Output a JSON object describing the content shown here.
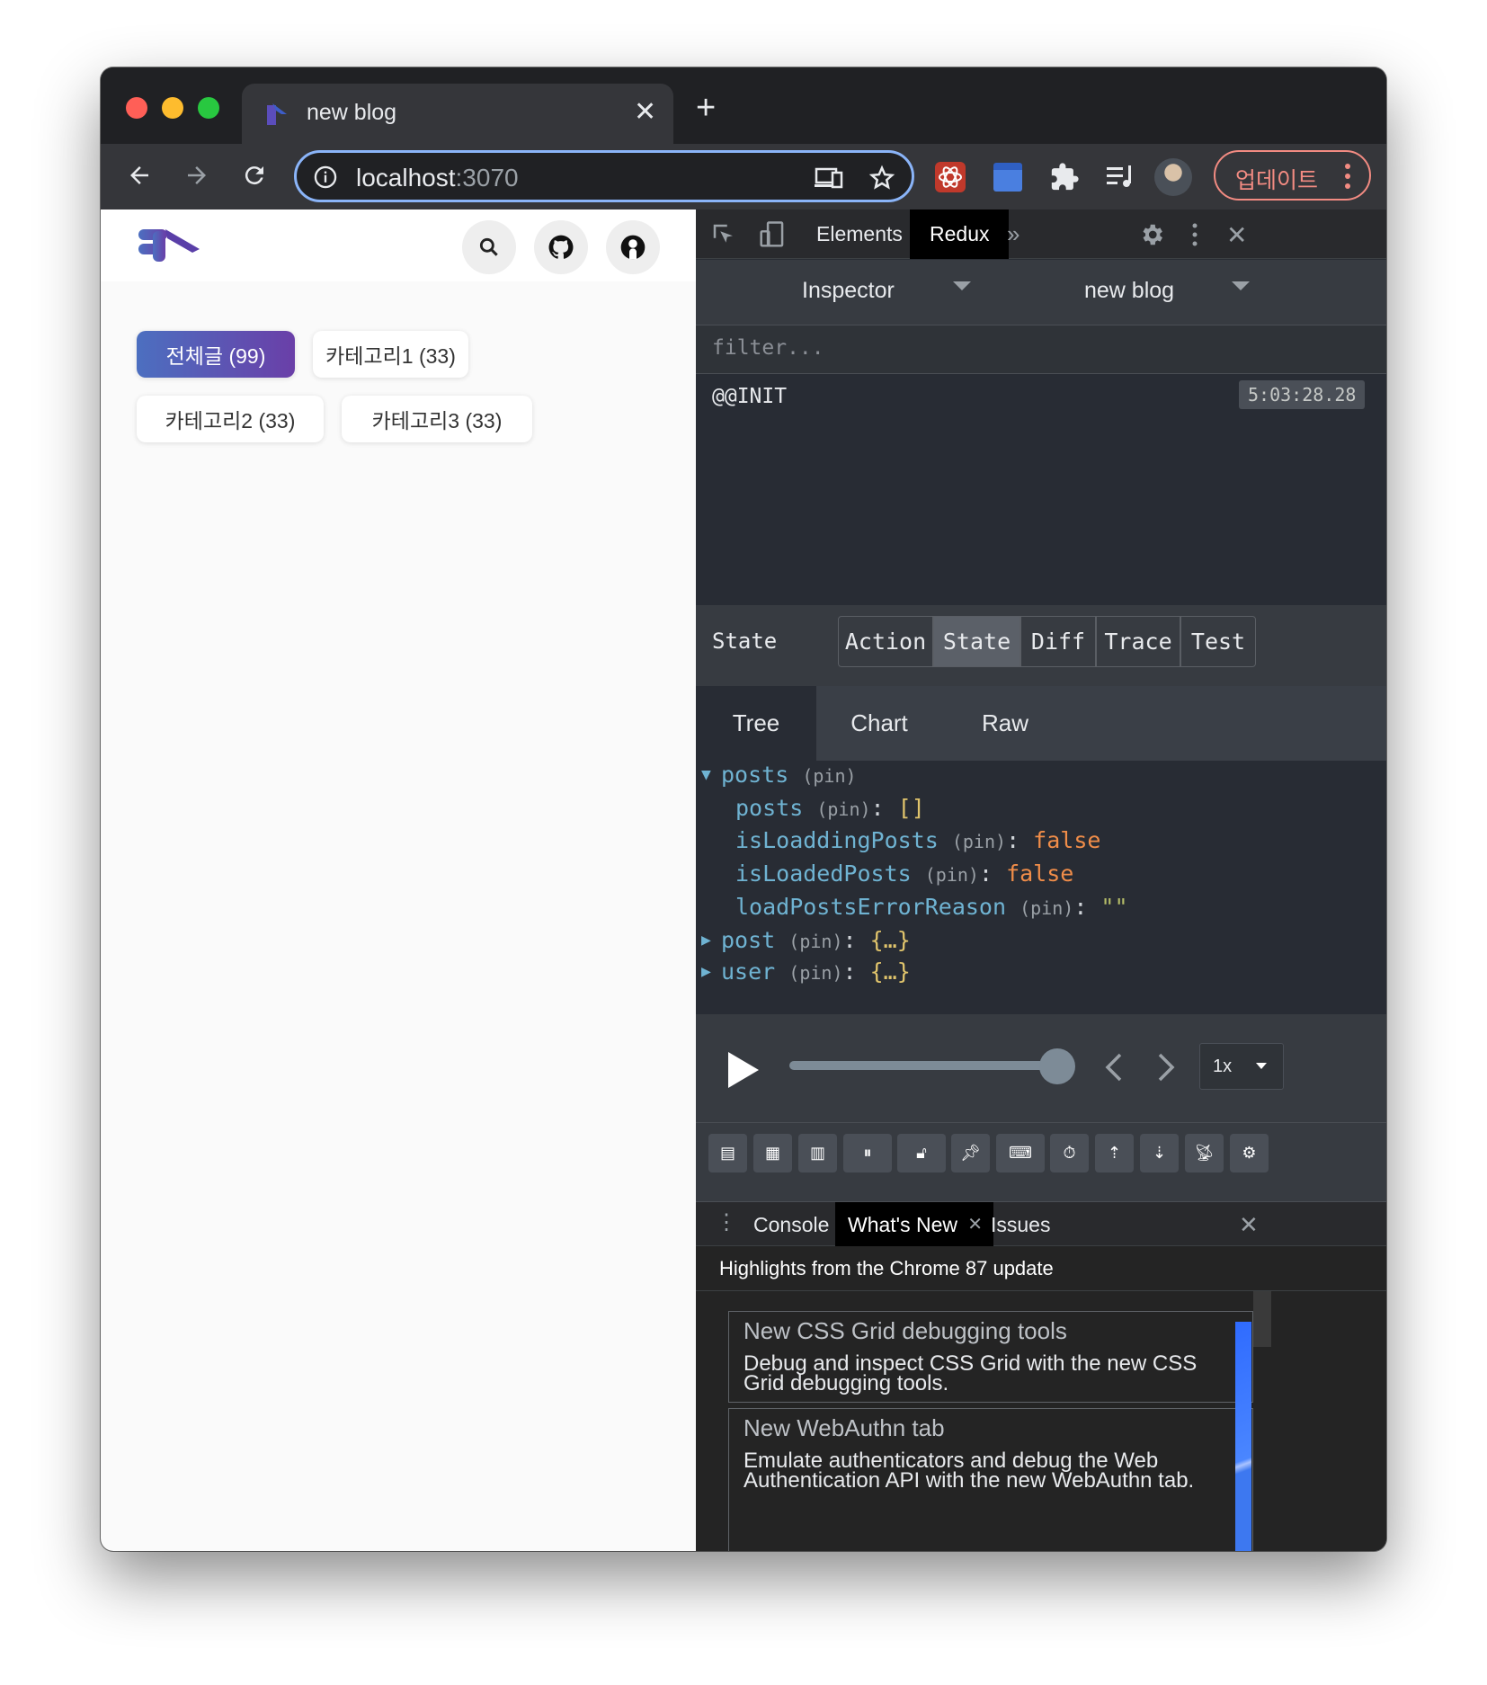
{
  "browser": {
    "tab_title": "new blog",
    "tab_close": "✕",
    "new_tab": "+",
    "url_host": "localhost",
    "url_port": ":3070",
    "update_label": "업데이트"
  },
  "page": {
    "categories": [
      {
        "label": "전체글 (99)",
        "active": true
      },
      {
        "label": "카테고리1 (33)",
        "active": false
      },
      {
        "label": "카테고리2 (33)",
        "active": false
      },
      {
        "label": "카테고리3 (33)",
        "active": false
      }
    ]
  },
  "devtools": {
    "tabs": [
      "Elements",
      "Redux"
    ],
    "active_tab": "Redux",
    "redux": {
      "monitor": "Inspector",
      "instance": "new blog",
      "filter_placeholder": "filter...",
      "actions": [
        {
          "name": "@@INIT",
          "time": "5:03:28.28"
        }
      ],
      "panel_title": "State",
      "segments": [
        "Action",
        "State",
        "Diff",
        "Trace",
        "Test"
      ],
      "active_segment": "State",
      "view_tabs": [
        "Tree",
        "Chart",
        "Raw"
      ],
      "active_view": "Tree",
      "tree": {
        "root_key": "posts",
        "pin": "(pin)",
        "rows": [
          {
            "key": "posts",
            "value": "[]",
            "type": "array"
          },
          {
            "key": "isLoaddingPosts",
            "value": "false",
            "type": "bool"
          },
          {
            "key": "isLoadedPosts",
            "value": "false",
            "type": "bool"
          },
          {
            "key": "loadPostsErrorReason",
            "value": "\"\"",
            "type": "string"
          }
        ],
        "collapsed": [
          {
            "key": "post",
            "value": "{…}"
          },
          {
            "key": "user",
            "value": "{…}"
          }
        ]
      },
      "slider": {
        "speed": "1x",
        "position": 1.0
      }
    },
    "drawer": {
      "tabs": [
        "Console",
        "What's New",
        "Issues"
      ],
      "active_tab": "What's New",
      "highlights": "Highlights from the Chrome 87 update",
      "news": [
        {
          "title": "New CSS Grid debugging tools",
          "desc": "Debug and inspect CSS Grid with the new CSS Grid debugging tools."
        },
        {
          "title": "New WebAuthn tab",
          "desc": "Emulate authenticators and debug the Web Authentication API with the new WebAuthn tab."
        }
      ]
    }
  },
  "colors": {
    "accent": "#8ab4f8",
    "key": "#6fb3d2",
    "bool": "#f08d49",
    "update": "#f28b82"
  }
}
